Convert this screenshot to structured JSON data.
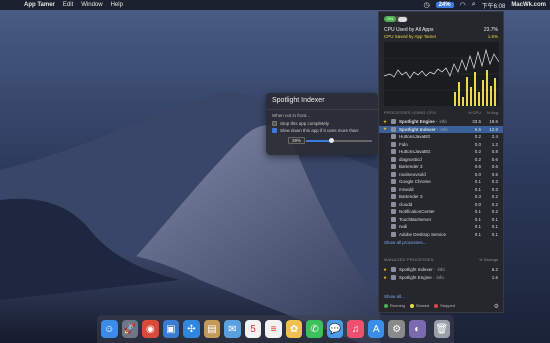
{
  "menubar": {
    "app_name": "App Tamer",
    "menu_items": [
      "Edit",
      "Window",
      "Help"
    ],
    "cpu_badge": "24%",
    "clock": "下午6:08",
    "site": "MacWk.com"
  },
  "spotlight_popover": {
    "title": "Spotlight Indexer",
    "when_label": "When not in front...",
    "stop_label": "Stop this app completely",
    "slow_label": "Slow down this app if it uses more than:",
    "slow_value": "39%",
    "slider_fraction": 0.39
  },
  "panel": {
    "toggle_label": "ON",
    "cpu_all_label": "CPU Used by All Apps",
    "cpu_all_value": "23.7%",
    "cpu_saved_label": "CPU Saved by App Tamer",
    "cpu_saved_value": "1.6%",
    "processes_header": "PROCESSES USING CPU",
    "col_cpu": "% CPU",
    "col_avg": "% Avg",
    "processes": [
      {
        "name": "Spotlight Engine",
        "tag": "info",
        "cpu": "33.5",
        "avg": "18.6",
        "starred": true,
        "selected": false,
        "bold": true
      },
      {
        "name": "Spotlight Indexer",
        "tag": "info",
        "cpu": "6.6",
        "avg": "12.8",
        "starred": true,
        "selected": true,
        "bold": true
      },
      {
        "name": "HuttonsJavaBG",
        "tag": "",
        "cpu": "0.2",
        "avg": "2.4",
        "starred": false,
        "selected": false,
        "bold": false
      },
      {
        "name": "Fido",
        "tag": "",
        "cpu": "0.0",
        "avg": "1.2",
        "starred": false,
        "selected": false,
        "bold": false
      },
      {
        "name": "HuttonsJavaBG",
        "tag": "",
        "cpu": "0.2",
        "avg": "0.8",
        "starred": false,
        "selected": false,
        "bold": false
      },
      {
        "name": "diagnosticd",
        "tag": "",
        "cpu": "0.2",
        "avg": "0.6",
        "starred": false,
        "selected": false,
        "bold": false
      },
      {
        "name": "Bartender 3",
        "tag": "",
        "cpu": "0.6",
        "avg": "0.6",
        "starred": false,
        "selected": false,
        "bold": false
      },
      {
        "name": "routineovsold",
        "tag": "",
        "cpu": "0.0",
        "avg": "0.5",
        "starred": false,
        "selected": false,
        "bold": false
      },
      {
        "name": "Google Chrome",
        "tag": "",
        "cpu": "0.1",
        "avg": "0.3",
        "starred": false,
        "selected": false,
        "bold": false
      },
      {
        "name": "mrwold",
        "tag": "",
        "cpu": "0.1",
        "avg": "0.3",
        "starred": false,
        "selected": false,
        "bold": false
      },
      {
        "name": "Bartender 3",
        "tag": "",
        "cpu": "0.3",
        "avg": "0.2",
        "starred": false,
        "selected": false,
        "bold": false
      },
      {
        "name": "cloudd",
        "tag": "",
        "cpu": "0.0",
        "avg": "0.2",
        "starred": false,
        "selected": false,
        "bold": false
      },
      {
        "name": "NotificationCenter",
        "tag": "",
        "cpu": "0.1",
        "avg": "0.2",
        "starred": false,
        "selected": false,
        "bold": false
      },
      {
        "name": "TouchBarServer",
        "tag": "",
        "cpu": "0.1",
        "avg": "0.1",
        "starred": false,
        "selected": false,
        "bold": false
      },
      {
        "name": "rwdi",
        "tag": "",
        "cpu": "0.1",
        "avg": "0.1",
        "starred": false,
        "selected": false,
        "bold": false
      },
      {
        "name": "Adobe Desktop Service",
        "tag": "",
        "cpu": "0.1",
        "avg": "0.1",
        "starred": false,
        "selected": false,
        "bold": false
      }
    ],
    "show_all_processes": "Show all processes...",
    "managed_header": "MANAGED PROCESSES",
    "managed_col": "% Savings",
    "managed": [
      {
        "name": "Spotlight Indexer",
        "tag": "info",
        "value": "6.2"
      },
      {
        "name": "Spotlight Engine",
        "tag": "info",
        "value": "1.6"
      }
    ],
    "show_all": "Show all...",
    "legend": [
      {
        "label": "Running",
        "color": "#4caf50"
      },
      {
        "label": "Slowed",
        "color": "#ecd84a"
      },
      {
        "label": "Stopped",
        "color": "#e04646"
      }
    ],
    "graph_line_color": "#e8e8e8",
    "graph_bar_color": "#ecd84a"
  },
  "dock": {
    "apps": [
      {
        "icon": "finder-icon",
        "color": "#3d8be8",
        "glyph": "☺"
      },
      {
        "icon": "launchpad-icon",
        "color": "#6d7587",
        "glyph": "🚀"
      },
      {
        "icon": "chrome-icon",
        "color": "#d84a3a",
        "glyph": "◉"
      },
      {
        "icon": "preview-icon",
        "color": "#3a7bd0",
        "glyph": "▣"
      },
      {
        "icon": "safari-icon",
        "color": "#2e86de",
        "glyph": "✣"
      },
      {
        "icon": "notes-icon",
        "color": "#c49a5a",
        "glyph": "▤"
      },
      {
        "icon": "mail-icon",
        "color": "#5aa0e0",
        "glyph": "✉"
      },
      {
        "icon": "calendar-icon",
        "color": "#f2f2f2",
        "glyph": "5"
      },
      {
        "icon": "reminders-icon",
        "color": "#f2f2f2",
        "glyph": "≡"
      },
      {
        "icon": "photos-icon",
        "color": "#f0c050",
        "glyph": "✿"
      },
      {
        "icon": "messages-icon",
        "color": "#3ac15a",
        "glyph": "✆"
      },
      {
        "icon": "facetime-icon",
        "color": "#4a9be8",
        "glyph": "💬"
      },
      {
        "icon": "music-icon",
        "color": "#f05070",
        "glyph": "♫"
      },
      {
        "icon": "app-store-icon",
        "color": "#3a8ee8",
        "glyph": "A"
      },
      {
        "icon": "system-preferences-icon",
        "color": "#8a8a8a",
        "glyph": "⚙"
      },
      {
        "icon": "app-tamer-icon",
        "color": "#7a6ab0",
        "glyph": "◐"
      },
      {
        "icon": "trash-icon",
        "color": "#9aa0aa",
        "glyph": "🗑"
      }
    ]
  }
}
